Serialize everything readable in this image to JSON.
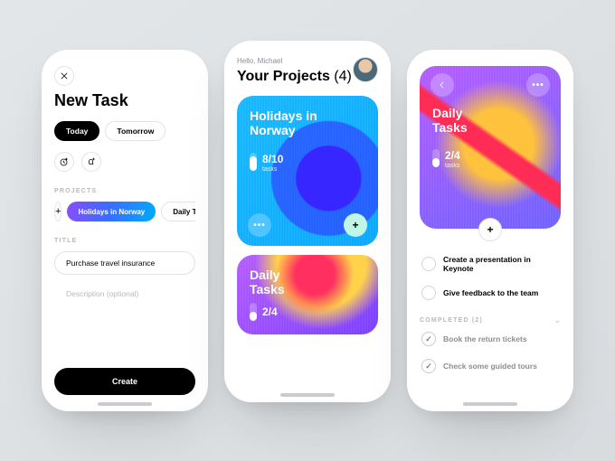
{
  "phone1": {
    "title": "New Task",
    "day_tabs": {
      "today": "Today",
      "tomorrow": "Tomorrow"
    },
    "section_projects": "PROJECTS",
    "project_primary": "Holidays in Norway",
    "project_secondary": "Daily T",
    "section_title": "TITLE",
    "title_value": "Purchase travel insurance",
    "desc_placeholder": "Description (optional)",
    "create_label": "Create"
  },
  "phone2": {
    "greeting": "Hello, Michael",
    "heading": "Your Projects",
    "count": "(4)",
    "card1": {
      "title": "Holidays in Norway",
      "ratio": "8/10",
      "unit": "tasks"
    },
    "card2": {
      "title": "Daily Tasks",
      "ratio": "2/4"
    }
  },
  "phone3": {
    "card": {
      "title": "Daily Tasks",
      "ratio": "2/4",
      "unit": "tasks"
    },
    "todo": [
      "Create a presentation in Keynote",
      "Give feedback to the team"
    ],
    "completed_label": "COMPLETED (2)",
    "done": [
      "Book the return tickets",
      "Check some guided tours"
    ]
  }
}
